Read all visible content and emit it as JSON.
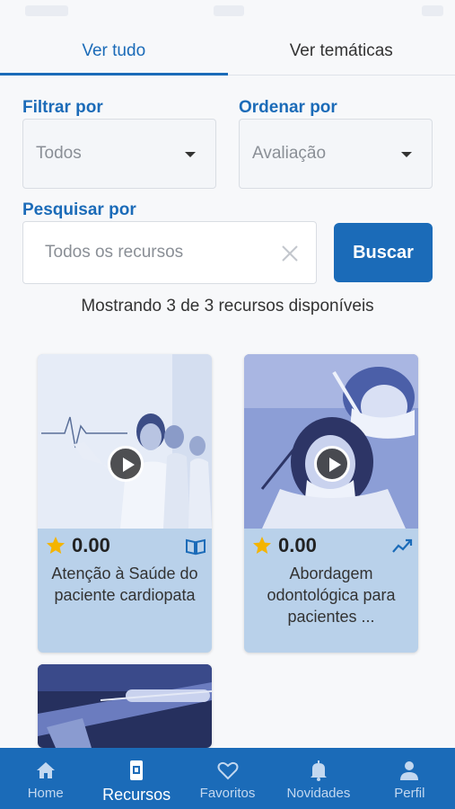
{
  "tabs": [
    {
      "label": "Ver tudo",
      "active": true
    },
    {
      "label": "Ver temáticas",
      "active": false
    }
  ],
  "filters": {
    "filter_label": "Filtrar por",
    "filter_value": "Todos",
    "order_label": "Ordenar por",
    "order_value": "Avaliação"
  },
  "search": {
    "label": "Pesquisar por",
    "placeholder": "Todos os recursos",
    "button_label": "Buscar"
  },
  "results": {
    "summary": "Mostrando 3 de 3 recursos disponíveis"
  },
  "cards": [
    {
      "rating": "0.00",
      "title": "Atenção à Saúde do paciente cardiopata",
      "type_icon": "book-open-icon"
    },
    {
      "rating": "0.00",
      "title": "Abordagem odontológica para pacientes ...",
      "type_icon": "trending-icon"
    },
    {
      "rating": "",
      "title": "",
      "type_icon": ""
    }
  ],
  "nav": [
    {
      "label": "Home",
      "icon": "home-icon",
      "active": false
    },
    {
      "label": "Recursos",
      "icon": "resources-icon",
      "active": true
    },
    {
      "label": "Favoritos",
      "icon": "heart-icon",
      "active": false
    },
    {
      "label": "Novidades",
      "icon": "bell-icon",
      "active": false
    },
    {
      "label": "Perfil",
      "icon": "person-icon",
      "active": false
    }
  ],
  "colors": {
    "primary": "#1b6bb8",
    "card_bg": "#b9d1ea",
    "star": "#f4b400"
  }
}
